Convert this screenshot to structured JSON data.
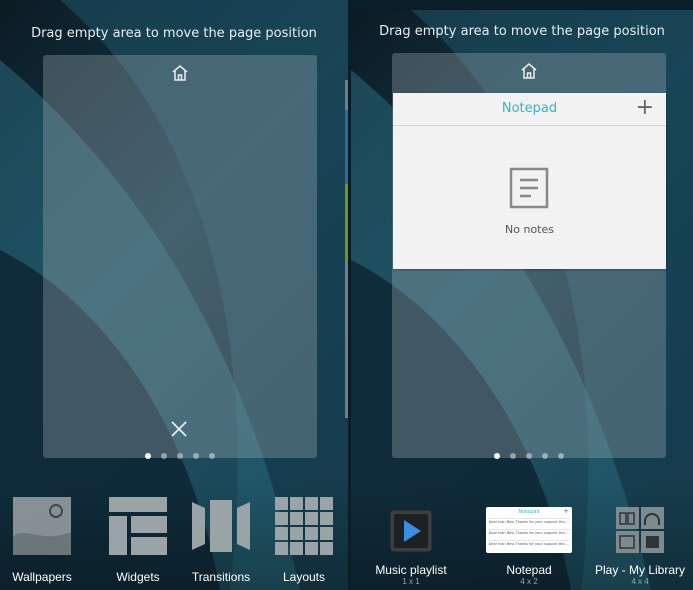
{
  "left_screen": {
    "hint": "Drag empty area to move the page position",
    "dots": [
      true,
      false,
      false,
      false,
      false
    ],
    "dock": [
      {
        "label": "Wallpapers",
        "icon": "wallpaper-icon"
      },
      {
        "label": "Widgets",
        "icon": "widgets-icon"
      },
      {
        "label": "Transitions",
        "icon": "transitions-icon"
      },
      {
        "label": "Layouts",
        "icon": "layouts-icon"
      }
    ]
  },
  "right_screen": {
    "hint": "Drag empty area to move the page position",
    "dots": [
      true,
      false,
      false,
      false,
      false
    ],
    "notepad_widget": {
      "title": "Notepad",
      "add_symbol": "+",
      "empty_text": "No notes"
    },
    "widget_tray": [
      {
        "label": "Music playlist",
        "size": "1 x 1",
        "icon": "play-icon"
      },
      {
        "label": "Notepad",
        "size": "4 x 2",
        "icon": "notepad-preview",
        "preview": {
          "title": "Notepad",
          "add_symbol": "+",
          "rows": [
            "Dear Ivan Bevi,Thanks for your support this ...",
            "Dear Ivan Bevi,Thanks for your support this ...",
            "Dear Ivan Bevi,Thanks for your support this ..."
          ]
        }
      },
      {
        "label": "Play - My Library",
        "size": "4 x 4",
        "icon": "library-icon"
      }
    ]
  },
  "colors": {
    "accent": "#33b5c7",
    "card_bg": "#f2f2f2"
  }
}
